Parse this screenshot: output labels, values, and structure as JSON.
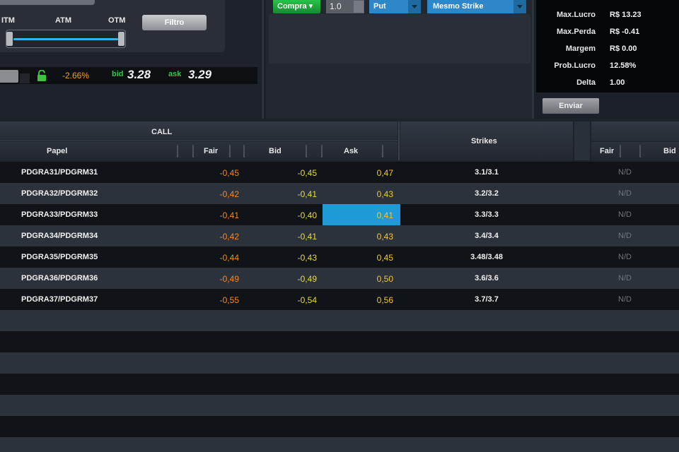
{
  "filter": {
    "itm_label": "ITM",
    "atm_label": "ATM",
    "otm_label": "OTM",
    "filter_button": "Filtro"
  },
  "quote": {
    "change": "-2.66%",
    "bid_label": "bid",
    "bid": "3.28",
    "ask_label": "ask",
    "ask": "3.29"
  },
  "order": {
    "side": "Compra",
    "quantity": "1.0",
    "option_type": "Put",
    "strike_mode": "Mesmo Strike"
  },
  "stats": [
    {
      "label": "Max.Lucro",
      "value": "R$ 13.23"
    },
    {
      "label": "Max.Perda",
      "value": "R$ -0.41"
    },
    {
      "label": "Margem",
      "value": "R$ 0.00"
    },
    {
      "label": "Prob.Lucro",
      "value": "12.58%"
    },
    {
      "label": "Delta",
      "value": "1.00"
    }
  ],
  "send_button": "Enviar",
  "table": {
    "group_call": "CALL",
    "col_papel": "Papel",
    "col_fair": "Fair",
    "col_bid": "Bid",
    "col_ask": "Ask",
    "col_strikes": "Strikes",
    "col_fair_right": "Fair",
    "col_bid_right": "Bid",
    "rows": [
      {
        "papel": "PDGRA31/PDGRM31",
        "fair": "-0,45",
        "bid": "-0,45",
        "ask": "0,47",
        "strike": "3.1/3.1",
        "fair_put": "N/D"
      },
      {
        "papel": "PDGRA32/PDGRM32",
        "fair": "-0,42",
        "bid": "-0,41",
        "ask": "0,43",
        "strike": "3.2/3.2",
        "fair_put": "N/D"
      },
      {
        "papel": "PDGRA33/PDGRM33",
        "fair": "-0,41",
        "bid": "-0,40",
        "ask": "0,41",
        "strike": "3.3/3.3",
        "fair_put": "N/D"
      },
      {
        "papel": "PDGRA34/PDGRM34",
        "fair": "-0,42",
        "bid": "-0,41",
        "ask": "0,43",
        "strike": "3.4/3.4",
        "fair_put": "N/D"
      },
      {
        "papel": "PDGRA35/PDGRM35",
        "fair": "-0,44",
        "bid": "-0,43",
        "ask": "0,45",
        "strike": "3.48/3.48",
        "fair_put": "N/D"
      },
      {
        "papel": "PDGRA36/PDGRM36",
        "fair": "-0,49",
        "bid": "-0,49",
        "ask": "0,50",
        "strike": "3.6/3.6",
        "fair_put": "N/D"
      },
      {
        "papel": "PDGRA37/PDGRM37",
        "fair": "-0,55",
        "bid": "-0,54",
        "ask": "0,56",
        "strike": "3.7/3.7",
        "fair_put": "N/D"
      }
    ]
  }
}
